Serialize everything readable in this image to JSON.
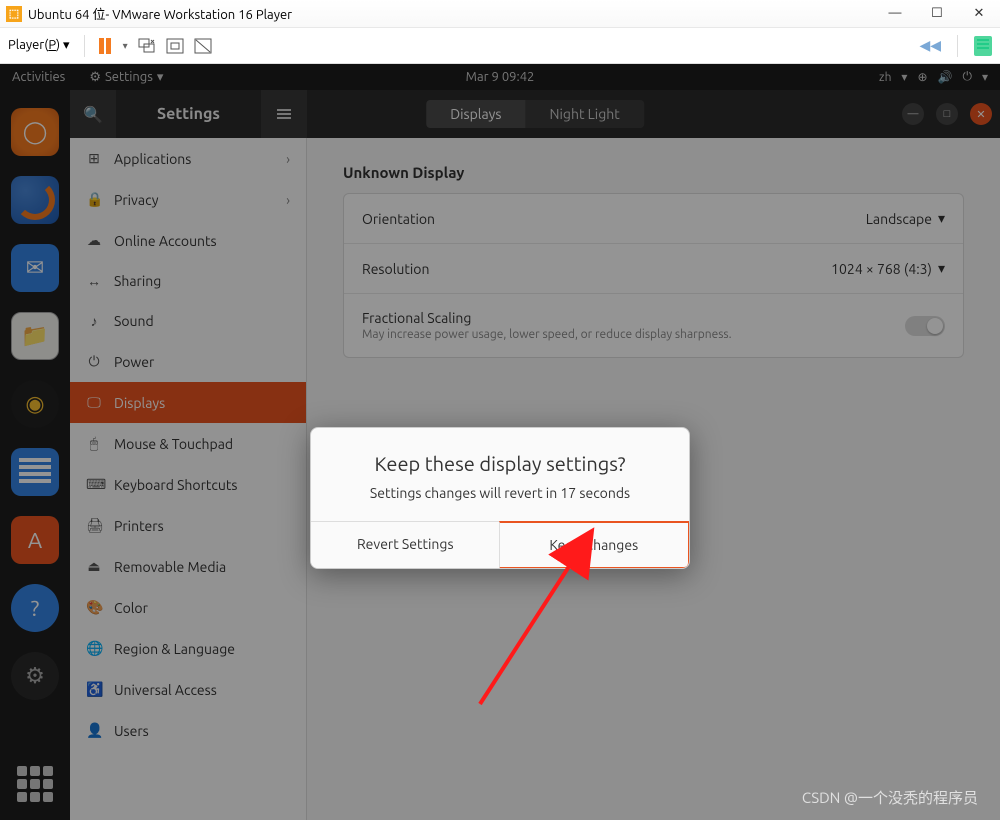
{
  "vmware": {
    "title": "Ubuntu 64 位- VMware Workstation 16 Player",
    "player_menu": "Player"
  },
  "topbar": {
    "activities": "Activities",
    "settings": "Settings",
    "time": "Mar 9  09:42",
    "lang": "zh"
  },
  "header": {
    "title": "Settings",
    "tab_displays": "Displays",
    "tab_night": "Night Light"
  },
  "sidebar": {
    "items": [
      {
        "icon": "⊞",
        "label": "Applications",
        "chevron": true
      },
      {
        "icon": "🔒",
        "label": "Privacy",
        "chevron": true
      },
      {
        "icon": "☁",
        "label": "Online Accounts"
      },
      {
        "icon": "↔",
        "label": "Sharing"
      },
      {
        "icon": "♪",
        "label": "Sound"
      },
      {
        "icon": "⏻",
        "label": "Power"
      },
      {
        "icon": "🖵",
        "label": "Displays",
        "selected": true
      },
      {
        "icon": "🖱",
        "label": "Mouse & Touchpad"
      },
      {
        "icon": "⌨",
        "label": "Keyboard Shortcuts"
      },
      {
        "icon": "🖨",
        "label": "Printers"
      },
      {
        "icon": "⏏",
        "label": "Removable Media"
      },
      {
        "icon": "🎨",
        "label": "Color"
      },
      {
        "icon": "🌐",
        "label": "Region & Language"
      },
      {
        "icon": "♿",
        "label": "Universal Access"
      },
      {
        "icon": "👤",
        "label": "Users"
      }
    ]
  },
  "display": {
    "section": "Unknown Display",
    "orientation_label": "Orientation",
    "orientation_value": "Landscape",
    "resolution_label": "Resolution",
    "resolution_value": "1024 × 768 (4:3)",
    "scaling_label": "Fractional Scaling",
    "scaling_sub": "May increase power usage, lower speed, or reduce display sharpness."
  },
  "dialog": {
    "title": "Keep these display settings?",
    "message": "Settings changes will revert in 17 seconds",
    "revert": "Revert Settings",
    "keep": "Keep Changes"
  },
  "watermark": "CSDN @一个没秃的程序员"
}
